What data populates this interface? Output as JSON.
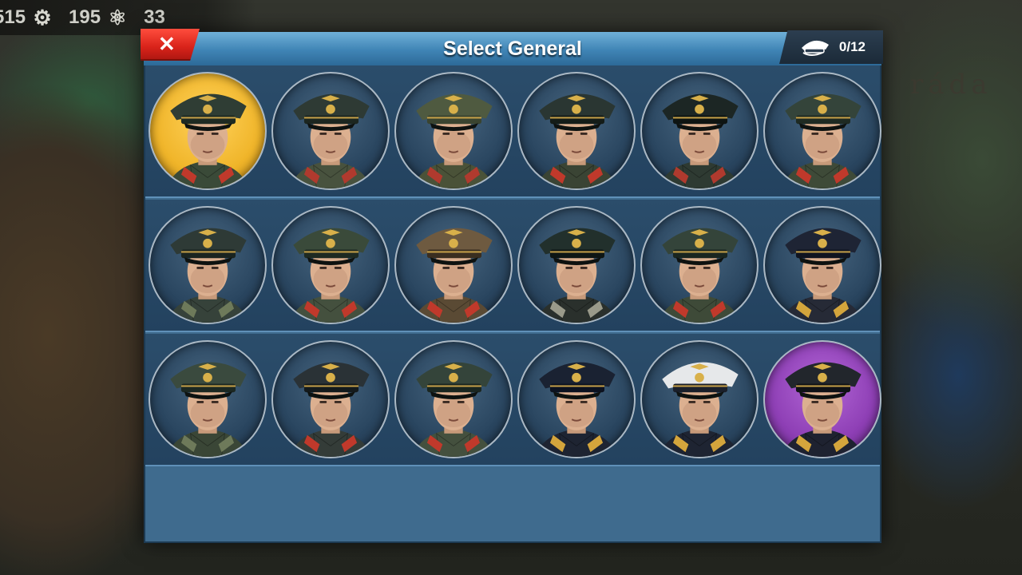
{
  "resources": [
    {
      "value": "515",
      "icon": "gear-icon"
    },
    {
      "value": "195",
      "icon": "atom-icon"
    },
    {
      "value": "33",
      "icon": ""
    }
  ],
  "dialog": {
    "title": "Select General",
    "close_icon": "close-icon",
    "selected_count": "0/12",
    "count_icon": "officer-cap-icon"
  },
  "generals": [
    {
      "rarity": "gold",
      "cap": "#2f3d34",
      "band": "#1e2a22",
      "collar": "#3a4a38",
      "tabs": "#c0392b"
    },
    {
      "rarity": "normal",
      "cap": "#2e3a34",
      "band": "#1c2620",
      "collar": "#48523e",
      "tabs": "#b03a2e"
    },
    {
      "rarity": "normal",
      "cap": "#4f5a40",
      "band": "#3a4430",
      "collar": "#4a5238",
      "tabs": "#b03a2e"
    },
    {
      "rarity": "normal",
      "cap": "#2a3632",
      "band": "#141c18",
      "collar": "#3a4434",
      "tabs": "#c0392b"
    },
    {
      "rarity": "normal",
      "cap": "#1c2624",
      "band": "#0e1412",
      "collar": "#2e3a32",
      "tabs": "#b03a2e"
    },
    {
      "rarity": "normal",
      "cap": "#34443a",
      "band": "#1e2a22",
      "collar": "#3e4a38",
      "tabs": "#c0392b"
    },
    {
      "rarity": "normal",
      "cap": "#2e3a36",
      "band": "#1a2420",
      "collar": "#36423a",
      "tabs": "#6e7a5a"
    },
    {
      "rarity": "normal",
      "cap": "#3a4a3a",
      "band": "#1e2a22",
      "collar": "#44503e",
      "tabs": "#c0392b"
    },
    {
      "rarity": "normal",
      "cap": "#6e5a40",
      "band": "#3a2e20",
      "collar": "#5a4a34",
      "tabs": "#c0392b"
    },
    {
      "rarity": "normal",
      "cap": "#22302c",
      "band": "#0e1614",
      "collar": "#2a302c",
      "tabs": "#9a9a8a"
    },
    {
      "rarity": "normal",
      "cap": "#34443a",
      "band": "#1a2620",
      "collar": "#3e4a38",
      "tabs": "#c0392b"
    },
    {
      "rarity": "normal",
      "cap": "#1e2434",
      "band": "#101420",
      "collar": "#262a36",
      "tabs": "#d4a53c"
    },
    {
      "rarity": "normal",
      "cap": "#3a4a3e",
      "band": "#1c2822",
      "collar": "#3a4636",
      "tabs": "#6e7a5a"
    },
    {
      "rarity": "normal",
      "cap": "#2a3236",
      "band": "#141a1c",
      "collar": "#343c38",
      "tabs": "#c0392b"
    },
    {
      "rarity": "normal",
      "cap": "#34443a",
      "band": "#1a2620",
      "collar": "#44503e",
      "tabs": "#c0392b"
    },
    {
      "rarity": "normal",
      "cap": "#1a2232",
      "band": "#0c1220",
      "collar": "#1e2432",
      "tabs": "#d4a53c"
    },
    {
      "rarity": "normal",
      "cap": "#e6e8ea",
      "band": "#1a1f2a",
      "collar": "#1e2432",
      "tabs": "#d4a53c"
    },
    {
      "rarity": "purple",
      "cap": "#22262c",
      "band": "#101216",
      "collar": "#1e2230",
      "tabs": "#d4a53c"
    }
  ]
}
